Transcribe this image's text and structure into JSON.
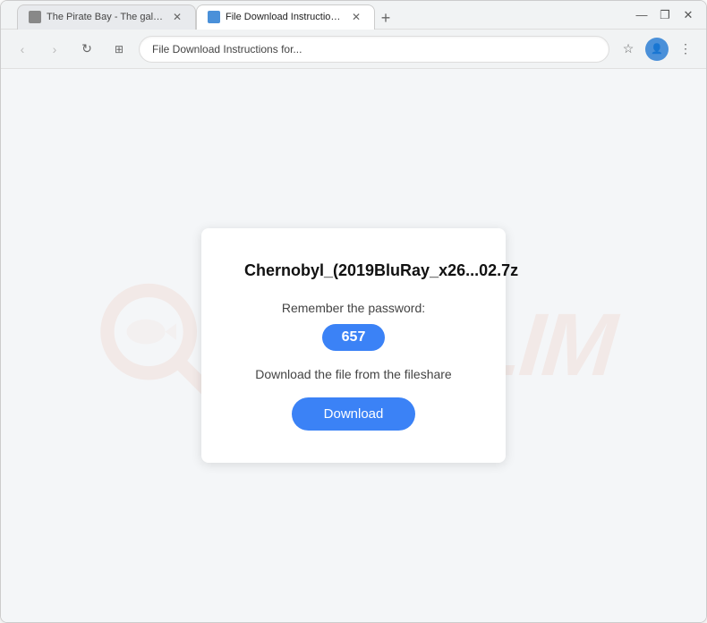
{
  "browser": {
    "tabs": [
      {
        "id": "tab-1",
        "title": "The Pirate Bay - The galaxy's m...",
        "favicon_color": "#888",
        "active": false
      },
      {
        "id": "tab-2",
        "title": "File Download Instructions for...",
        "favicon_color": "#4a90d9",
        "active": true
      }
    ],
    "new_tab_label": "+",
    "url": "File Download Instructions for...",
    "nav": {
      "back": "‹",
      "forward": "›",
      "refresh": "↻",
      "custom": "⊞"
    },
    "controls": {
      "minimize": "—",
      "maximize": "❐",
      "close": "✕"
    },
    "toolbar_icons": {
      "star": "☆",
      "profile": "👤",
      "menu": "⋮"
    }
  },
  "watermark": {
    "text": "FISH.LIM"
  },
  "card": {
    "filename": "Chernobyl_(2019BluRay_x26...02.7z",
    "password_label": "Remember the password:",
    "password_value": "657",
    "instruction": "Download the file from the fileshare",
    "download_button": "Download"
  }
}
